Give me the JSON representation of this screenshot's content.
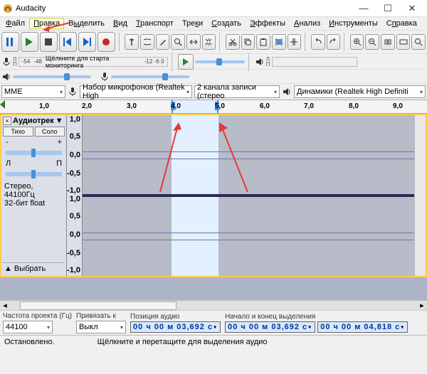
{
  "window": {
    "title": "Audacity"
  },
  "menu": {
    "items": [
      "Файл",
      "Правка",
      "Выделить",
      "Вид",
      "Транспорт",
      "Треки",
      "Создать",
      "Эффекты",
      "Анализ",
      "Инструменты",
      "Справка"
    ]
  },
  "transport": {
    "pause": "pause",
    "play": "play",
    "stop": "stop",
    "skip_start": "skip-start",
    "skip_end": "skip-end",
    "record": "record"
  },
  "meter": {
    "rec_hint": "Щёлкните для старта мониторинга",
    "ticks": [
      "-54",
      "-48",
      "-12",
      "-6",
      "0"
    ]
  },
  "devices": {
    "host": "MME",
    "rec_device": "Набор микрофонов (Realtek High",
    "rec_channels": "2 канала записи (стерео",
    "play_device": "Динамики (Realtek High Definiti"
  },
  "ruler": {
    "ticks": [
      "1,0",
      "2,0",
      "3,0",
      "4,0",
      "5,0",
      "6,0",
      "7,0",
      "8,0",
      "9,0"
    ]
  },
  "track": {
    "name": "Аудиотрек",
    "mute": "Тихо",
    "solo": "Соло",
    "info1": "Стерео, 44100Гц",
    "info2": "32-бит float",
    "select": "Выбрать",
    "vlabels": [
      "1,0",
      "0,5",
      "0,0",
      "-0,5",
      "-1,0",
      "1,0",
      "0,5",
      "0,0",
      "-0,5",
      "-1,0"
    ]
  },
  "status": {
    "project_rate_label": "Частота проекта (Гц)",
    "project_rate": "44100",
    "snap_label": "Привязать к",
    "snap": "Выкл",
    "pos_label": "Позиция аудио",
    "pos": "00 ч 00 м 03,692 с",
    "sel_label": "Начало и конец выделения",
    "sel_start": "00 ч 00 м 03,692 с",
    "sel_end": "00 ч 00 м 04,818 с",
    "state": "Остановлено.",
    "hint": "Щёлкните и перетащите для выделения аудио"
  }
}
